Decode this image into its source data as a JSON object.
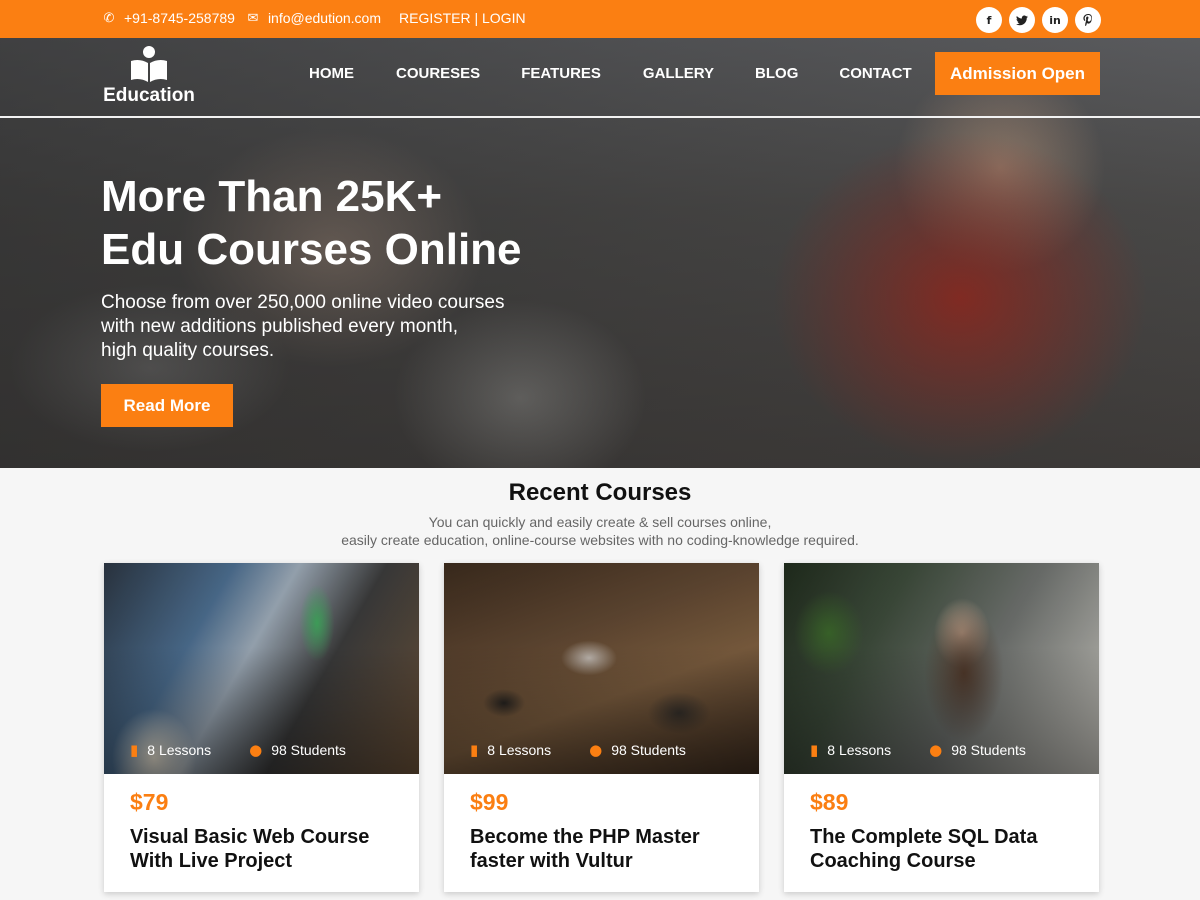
{
  "topbar": {
    "phone": "+91-8745-258789",
    "email": "info@edution.com",
    "register": "REGISTER",
    "divider": "|",
    "login": "LOGIN",
    "social": [
      {
        "icon": "facebook-icon",
        "glyph": "f"
      },
      {
        "icon": "twitter-icon",
        "glyph": "t"
      },
      {
        "icon": "linkedin-icon",
        "glyph": "in"
      },
      {
        "icon": "pinterest-icon",
        "glyph": "p"
      }
    ],
    "bg_color": "#fb7f12"
  },
  "nav": {
    "logo_text": "Education",
    "items": [
      "HOME",
      "COURESES",
      "FEATURES",
      "GALLERY",
      "BLOG",
      "CONTACT"
    ],
    "cta_label": "Admission Open"
  },
  "hero": {
    "title_line1": "More Than 25K+",
    "title_line2": "Edu Courses Online",
    "subtitle_line1": "Choose from over 250,000 online video courses",
    "subtitle_line2": "with new additions published every month,",
    "subtitle_line3": "high quality courses.",
    "button_label": "Read More"
  },
  "recent": {
    "title": "Recent Courses",
    "subtitle_line1": "You can quickly and easily create & sell courses online,",
    "subtitle_line2": "easily create education, online-course websites with no coding-knowledge required.",
    "courses": [
      {
        "lessons": "8 Lessons",
        "students": "98 Students",
        "price": "$79",
        "title": "Visual Basic Web Course With Live Project"
      },
      {
        "lessons": "8 Lessons",
        "students": "98 Students",
        "price": "$99",
        "title": "Become the PHP Master faster with Vultur"
      },
      {
        "lessons": "8 Lessons",
        "students": "98 Students",
        "price": "$89",
        "title": "The Complete SQL Data Coaching Course"
      }
    ]
  },
  "accent_color": "#fb7f12"
}
